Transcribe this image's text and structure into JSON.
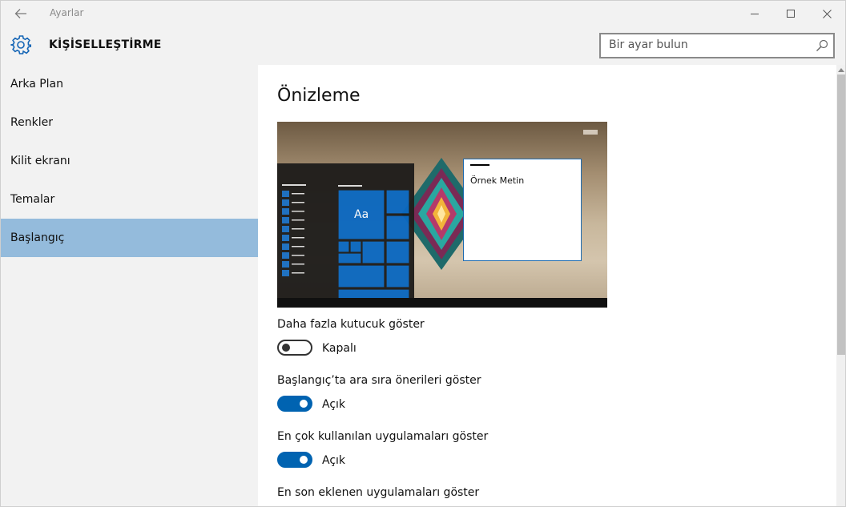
{
  "window": {
    "title": "Ayarlar"
  },
  "header": {
    "title": "KİŞİSELLEŞTİRME"
  },
  "search": {
    "placeholder": "Bir ayar bulun"
  },
  "sidebar": {
    "items": [
      {
        "label": "Arka Plan",
        "selected": false
      },
      {
        "label": "Renkler",
        "selected": false
      },
      {
        "label": "Kilit ekranı",
        "selected": false
      },
      {
        "label": "Temalar",
        "selected": false
      },
      {
        "label": "Başlangıç",
        "selected": true
      }
    ]
  },
  "main": {
    "section_title": "Önizleme",
    "preview": {
      "tile_label": "Aa",
      "sample_text": "Örnek Metin"
    },
    "settings": [
      {
        "label": "Daha fazla kutucuk göster",
        "state": "Kapalı",
        "on": false
      },
      {
        "label": "Başlangıç’ta ara sıra önerileri göster",
        "state": "Açık",
        "on": true
      },
      {
        "label": "En çok kullanılan uygulamaları göster",
        "state": "Açık",
        "on": true
      },
      {
        "label": "En son eklenen uygulamaları göster"
      }
    ]
  },
  "colors": {
    "accent": "#0063b1",
    "selected_nav": "#94bbdc",
    "chrome": "#f2f2f2"
  },
  "icons": [
    "back-arrow-icon",
    "minimize-icon",
    "maximize-icon",
    "close-icon",
    "gear-icon",
    "search-icon"
  ]
}
